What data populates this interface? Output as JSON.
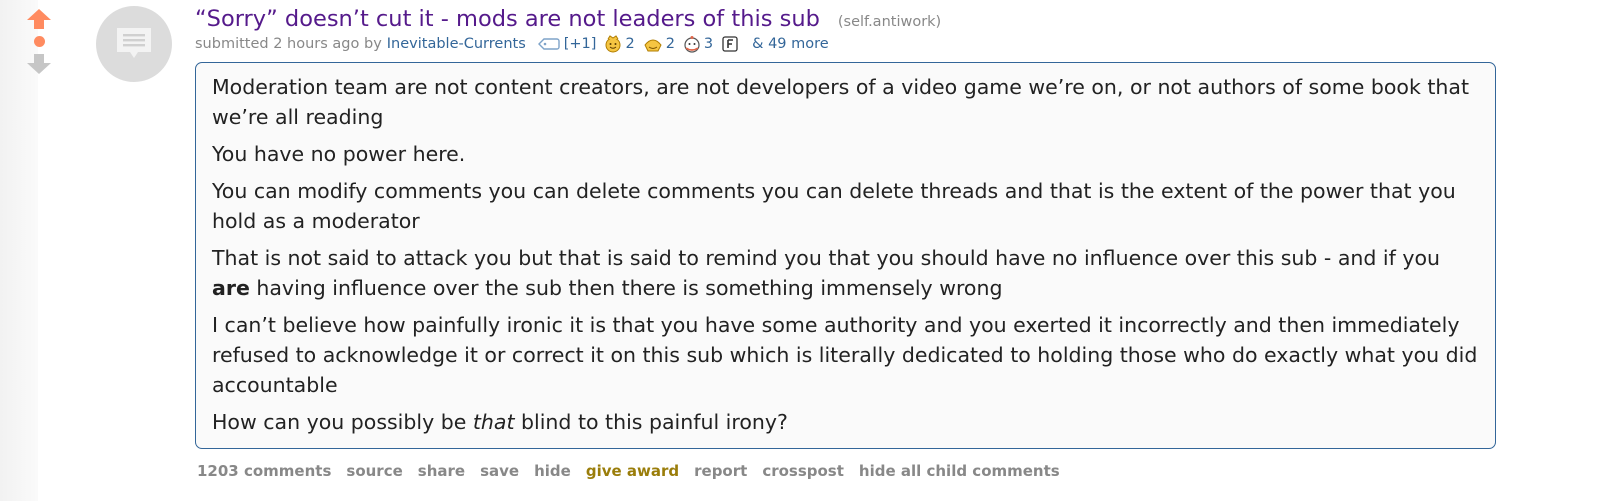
{
  "post": {
    "title": "“Sorry” doesn’t cut it - mods are not leaders of this sub",
    "domain": "(self.antiwork)",
    "tagline": {
      "submitted": "submitted 2 hours ago by",
      "author": "Inevitable-Currents",
      "flair_count": "[+1]",
      "awards": [
        {
          "icon": "wholesome-award-icon",
          "count": "2"
        },
        {
          "icon": "helpful-award-icon",
          "count": "2"
        },
        {
          "icon": "hugz-award-icon",
          "count": "3"
        },
        {
          "icon": "f-award-icon",
          "count": ""
        }
      ],
      "more": "& 49 more"
    },
    "body": {
      "p1": "Moderation team are not content creators, are not developers of a video game we’re on, or not authors of some book that we’re all reading",
      "p2": "You have no power here.",
      "p3": "You can modify comments you can delete comments you can delete threads and that is the extent of the power that you hold as a moderator",
      "p4_a": "That is not said to attack you but that is said to remind you that you should have no influence over this sub - and if you ",
      "p4_bold": "are",
      "p4_b": " having influence over the sub then there is something immensely wrong",
      "p5": "I can’t believe how painfully ironic it is that you have some authority and you exerted it incorrectly and then immediately refused to acknowledge it or correct it on this sub which is literally dedicated to holding those who do exactly what you did accountable",
      "p6_a": "How can you possibly be ",
      "p6_italic": "that",
      "p6_b": " blind to this painful irony?"
    },
    "buttons": {
      "comments": "1203 comments",
      "source": "source",
      "share": "share",
      "save": "save",
      "hide": "hide",
      "give_award": "give award",
      "report": "report",
      "crosspost": "crosspost",
      "hide_child": "hide all child comments"
    }
  },
  "colors": {
    "title": "#551a8b",
    "link": "#336699",
    "upvote": "#ff8b60",
    "gold": "#9a7d0a"
  }
}
